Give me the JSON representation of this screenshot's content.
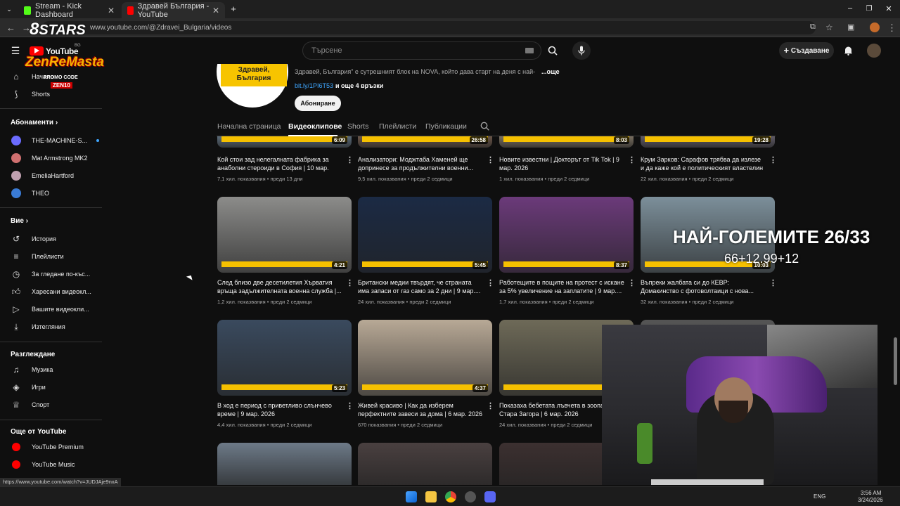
{
  "browser": {
    "tabs": [
      {
        "title": "Stream - Kick Dashboard",
        "color": "#53fc18"
      },
      {
        "title": "Здравей България - YouTube",
        "color": "#ff0000"
      }
    ],
    "url": "www.youtube.com/@Zdravei_Bulgaria/videos",
    "status_url": "https://www.youtube.com/watch?v=JUDJAje9nxA"
  },
  "youtube": {
    "logo_text": "YouTube",
    "logo_region": "BG",
    "search_placeholder": "Търсене",
    "create_label": "Създаване"
  },
  "sidebar": {
    "main": [
      {
        "label": "Начало",
        "icon": "home-icon"
      },
      {
        "label": "Shorts",
        "icon": "shorts-icon"
      }
    ],
    "subs_heading": "Абонаменти",
    "subscriptions": [
      {
        "label": "THE-MACHINE-S...",
        "color": "#6b6bff"
      },
      {
        "label": "Mat Armstrong MK2",
        "color": "#d07070"
      },
      {
        "label": "EmeliaHartford",
        "color": "#c0a0b0"
      },
      {
        "label": "THEO",
        "color": "#3a7bd5"
      }
    ],
    "you_heading": "Вие",
    "you": [
      {
        "label": "История",
        "icon": "history-icon"
      },
      {
        "label": "Плейлисти",
        "icon": "playlist-icon"
      },
      {
        "label": "За гледане по-къс...",
        "icon": "watch-later-icon"
      },
      {
        "label": "Харесани видеокл...",
        "icon": "like-icon"
      },
      {
        "label": "Вашите видеокли...",
        "icon": "your-videos-icon"
      },
      {
        "label": "Изтегляния",
        "icon": "download-icon"
      }
    ],
    "explore_heading": "Разглеждане",
    "explore": [
      {
        "label": "Музика",
        "icon": "music-icon"
      },
      {
        "label": "Игри",
        "icon": "gaming-icon"
      },
      {
        "label": "Спорт",
        "icon": "sports-icon"
      }
    ],
    "more_heading": "Още от YouTube",
    "more": [
      {
        "label": "YouTube Premium",
        "icon": "youtube-premium-icon"
      },
      {
        "label": "YouTube Music",
        "icon": "youtube-music-icon"
      }
    ]
  },
  "channel": {
    "avatar_text": "Здравей, България",
    "description": "Здравей, България\" е сутрешният блок на NOVA, който дава старт на деня с най-",
    "more_label": "...още",
    "link": "bit.ly/1PI6T53",
    "link_more": "и още 4 връзки",
    "subscribe_label": "Абониране"
  },
  "tabs": [
    "Начална страница",
    "Видеоклипове",
    "Shorts",
    "Плейлисти",
    "Публикации"
  ],
  "videos": [
    {
      "title": "Кой стои зад нелегалната фабрика за анаболни стероиди в София | 10 мар. 2026",
      "views": "7,1 хил. показвания",
      "age": "преди 13 дни",
      "duration": "6:09",
      "color": "#5a6a78"
    },
    {
      "title": "Анализатори: Моджтаба Хаменей ще допринесе за продължителни военни...",
      "views": "9,5 хил. показвания",
      "age": "преди 2 седмици",
      "duration": "26:58",
      "color": "#6a5548"
    },
    {
      "title": "Новите известни | Докторът от Tik Tok | 9 мар. 2026",
      "views": "1 хил. показвания",
      "age": "преди 2 седмици",
      "duration": "8:03",
      "color": "#7a6f60"
    },
    {
      "title": "Крум Зарков: Сарафов трябва да излезе и да каже кой е политическият властелин ...",
      "views": "22 хил. показвания",
      "age": "преди 2 седмици",
      "duration": "19:28",
      "color": "#5f5a66"
    },
    {
      "title": "След близо две десетилетия Хърватия връща задължителната военна служба |...",
      "views": "1,2 хил. показвания",
      "age": "преди 2 седмици",
      "duration": "4:21",
      "color": "#8c8c8a"
    },
    {
      "title": "Британски медии твърдят, че страната има запаси от газ само за 2 дни | 9 мар....",
      "views": "24 хил. показвания",
      "age": "преди 2 седмици",
      "duration": "5:45",
      "color": "#1b2a44"
    },
    {
      "title": "Работещите в пощите на протест с искане за 5% увеличение на заплатите | 9 мар....",
      "views": "1,7 хил. показвания",
      "age": "преди 2 седмици",
      "duration": "8:37",
      "color": "#6b3a7a"
    },
    {
      "title": "Въпреки жалбата си до КЕВР: Домакинство с фотоволтаици с нова...",
      "views": "32 хил. показвания",
      "age": "преди 2 седмици",
      "duration": "10:03",
      "color": "#7c8f9a"
    },
    {
      "title": "В ход е период с приветливо слънчево време | 9 мар. 2026",
      "views": "4,4 хил. показвания",
      "age": "преди 2 седмици",
      "duration": "5:23",
      "color": "#3a4a5e"
    },
    {
      "title": "Живей красиво | Как да изберем перфектните завеси за дома | 6 мар. 2026",
      "views": "670 показвания",
      "age": "преди 2 седмици",
      "duration": "4:37",
      "color": "#b8a996"
    },
    {
      "title": "Показаха бебетата лъвчета в зоопарка в Стара Загора | 6 мар. 2026",
      "views": "24 хил. показвания",
      "age": "преди 2 седмици",
      "duration": "",
      "color": "#6e6a58"
    },
    {
      "title": "",
      "views": "",
      "age": "",
      "duration": "",
      "color": "#555"
    },
    {
      "title": "",
      "views": "",
      "age": "",
      "duration": "",
      "color": "#6d7a88"
    },
    {
      "title": "",
      "views": "",
      "age": "",
      "duration": "",
      "color": "#4a4040"
    },
    {
      "title": "",
      "views": "",
      "age": "",
      "duration": "",
      "color": "#3c3030"
    }
  ],
  "overlay": {
    "stars": "STARS",
    "zen": "ZenReMasta",
    "promo": "PROMO CODE",
    "code": "ZEN10",
    "headline": "НАЙ-ГОЛЕМИТЕ 26/33",
    "score": "66+12.99+12"
  },
  "taskbar": {
    "lang": "ENG",
    "time": "3:56 AM",
    "date": "3/24/2026"
  }
}
